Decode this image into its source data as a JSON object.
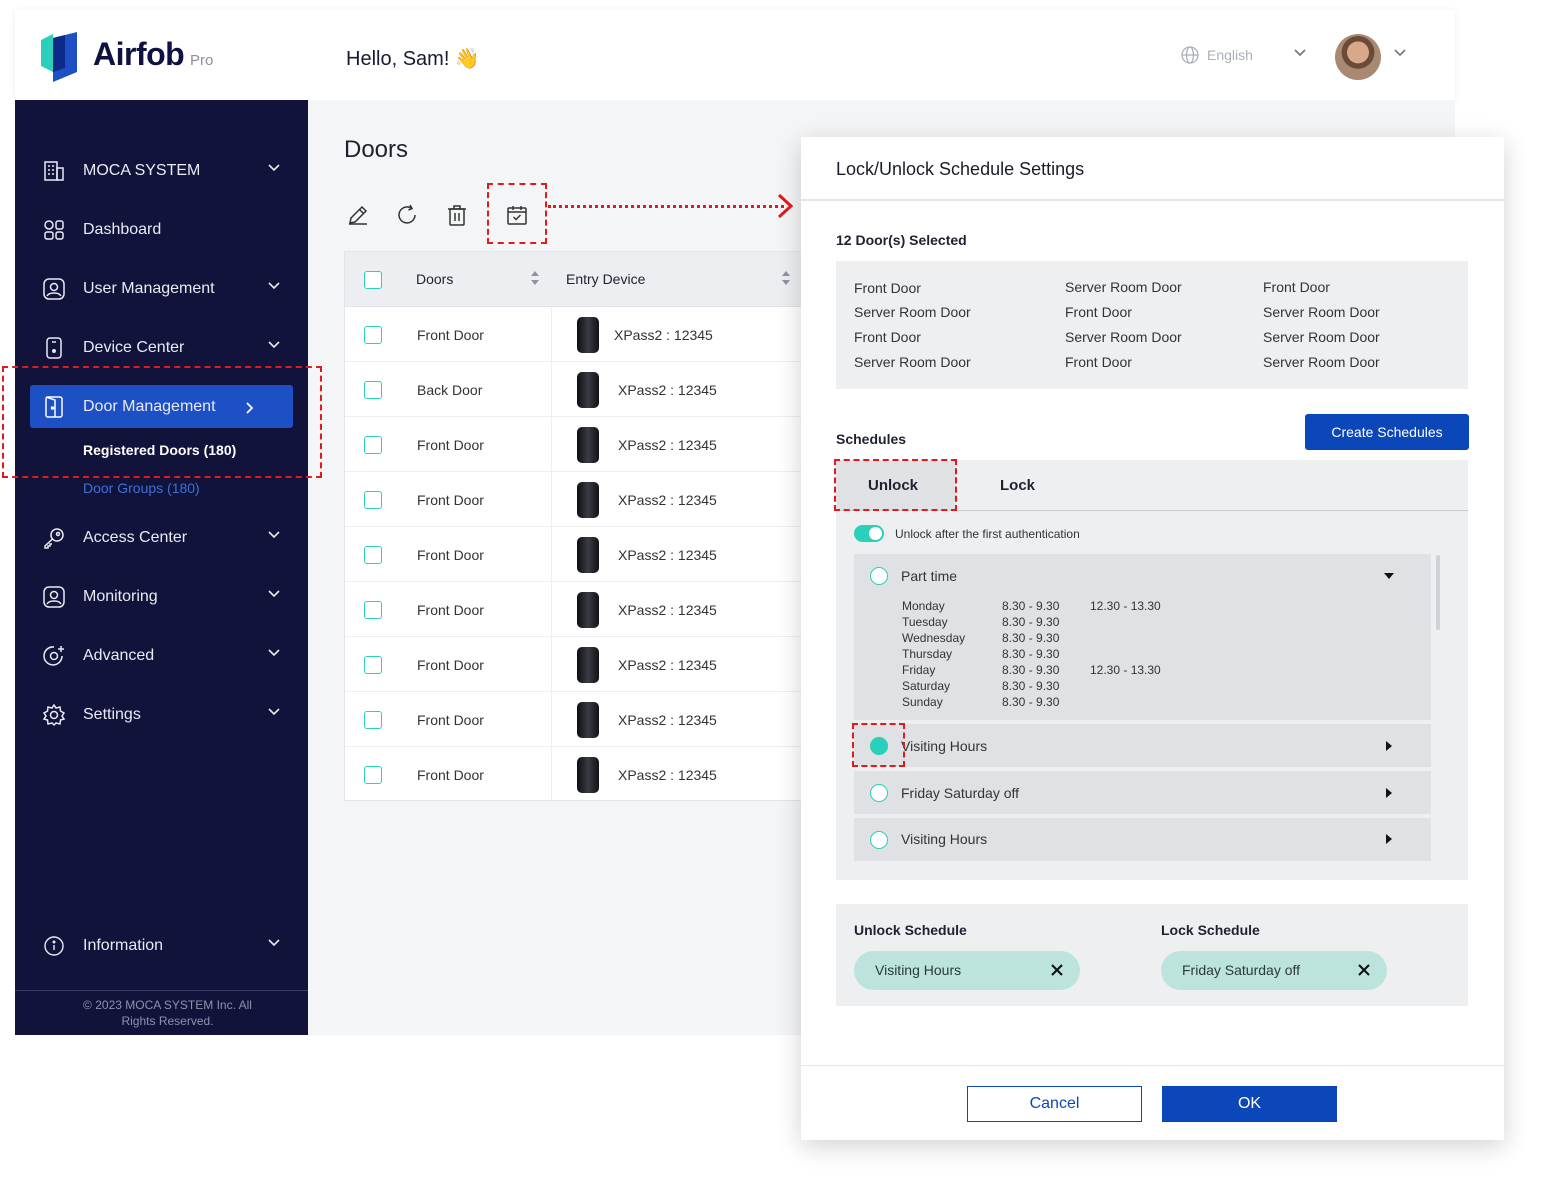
{
  "header": {
    "logo_text": "Airfob",
    "logo_suffix": "Pro",
    "greeting": "Hello, Sam! 👋",
    "language": "English"
  },
  "sidebar": {
    "items": [
      {
        "label": "MOCA SYSTEM",
        "icon": "building-icon"
      },
      {
        "label": "Dashboard",
        "icon": "grid-icon"
      },
      {
        "label": "User Management",
        "icon": "user-icon"
      },
      {
        "label": "Device Center",
        "icon": "device-icon"
      },
      {
        "label": "Door Management",
        "icon": "door-icon"
      },
      {
        "label": "Access Center",
        "icon": "key-icon"
      },
      {
        "label": "Monitoring",
        "icon": "monitor-user-icon"
      },
      {
        "label": "Advanced",
        "icon": "advanced-icon"
      },
      {
        "label": "Settings",
        "icon": "gear-icon"
      },
      {
        "label": "Information",
        "icon": "info-icon"
      }
    ],
    "sub_items": [
      "Registered Doors  (180)",
      "Door Groups  (180)"
    ],
    "copyright_line1": "© 2023 MOCA SYSTEM Inc. All",
    "copyright_line2": "Rights Reserved."
  },
  "main": {
    "title": "Doors",
    "table": {
      "headers": [
        "Doors",
        "Entry Device"
      ],
      "rows": [
        {
          "door": "Front Door",
          "device": "XPass2 : 12345"
        },
        {
          "door": "Back Door",
          "device": "XPass2 : 12345"
        },
        {
          "door": "Front Door",
          "device": "XPass2 : 12345"
        },
        {
          "door": "Front Door",
          "device": "XPass2 : 12345"
        },
        {
          "door": "Front Door",
          "device": "XPass2 : 12345"
        },
        {
          "door": "Front Door",
          "device": "XPass2 : 12345"
        },
        {
          "door": "Front Door",
          "device": "XPass2 : 12345"
        },
        {
          "door": "Front Door",
          "device": "XPass2 : 12345"
        },
        {
          "door": "Front Door",
          "device": "XPass2 : 12345"
        }
      ]
    }
  },
  "modal": {
    "title": "Lock/Unlock Schedule Settings",
    "selected_label": "12 Door(s) Selected",
    "selected_doors": [
      [
        "Front Door",
        "Server Room Door",
        "Front Door"
      ],
      [
        "Server Room Door",
        "Front Door",
        "Server Room Door"
      ],
      [
        "Front Door",
        "Server Room Door",
        "Server Room Door"
      ],
      [
        "Server Room Door",
        "Front Door",
        "Server Room Door"
      ]
    ],
    "schedules_label": "Schedules",
    "create_button": "Create Schedules",
    "tabs": [
      "Unlock",
      "Lock"
    ],
    "toggle_label": "Unlock after the first authentication",
    "schedule_items": [
      {
        "name": "Part time",
        "selected": false
      },
      {
        "name": "Visiting Hours",
        "selected": true
      },
      {
        "name": "Friday Saturday off",
        "selected": false
      },
      {
        "name": "Visiting Hours",
        "selected": false
      }
    ],
    "part_time_days": [
      {
        "day": "Monday",
        "t1": "8.30 - 9.30",
        "t2": "12.30 - 13.30"
      },
      {
        "day": "Tuesday",
        "t1": "8.30 - 9.30",
        "t2": ""
      },
      {
        "day": "Wednesday",
        "t1": "8.30 - 9.30",
        "t2": ""
      },
      {
        "day": "Thursday",
        "t1": "8.30 - 9.30",
        "t2": ""
      },
      {
        "day": "Friday",
        "t1": "8.30 - 9.30",
        "t2": "12.30 - 13.30"
      },
      {
        "day": "Saturday",
        "t1": "8.30 - 9.30",
        "t2": ""
      },
      {
        "day": "Sunday",
        "t1": "8.30 - 9.30",
        "t2": ""
      }
    ],
    "unlock_schedule_label": "Unlock Schedule",
    "lock_schedule_label": "Lock Schedule",
    "unlock_chip": "Visiting Hours",
    "lock_chip": "Friday Saturday off",
    "cancel": "Cancel",
    "ok": "OK"
  },
  "colors": {
    "sidebar_bg": "#11133b",
    "primary": "#0b47b8",
    "accent": "#2ad0b9",
    "highlight": "#e01b1b"
  }
}
